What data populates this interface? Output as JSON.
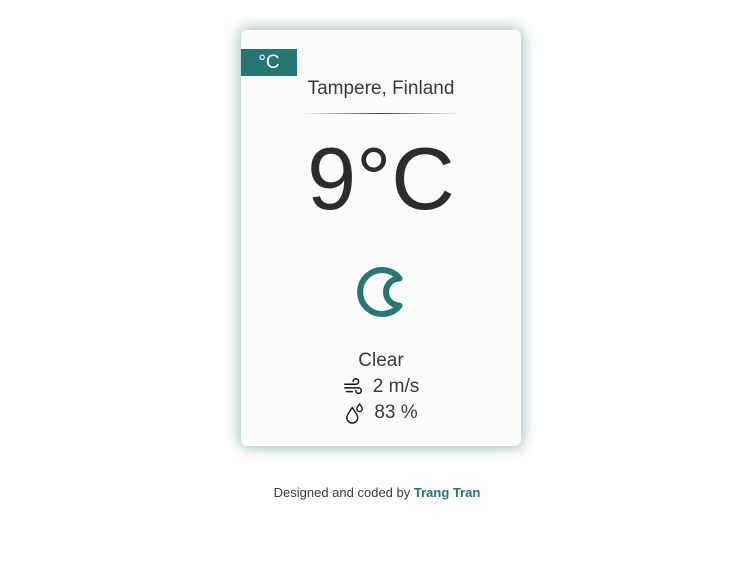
{
  "unit_toggle": {
    "label": "°C"
  },
  "location": "Tampere, Finland",
  "temperature": "9°C",
  "weather": {
    "icon": "crescent-moon-icon",
    "condition": "Clear",
    "wind": "2 m/s",
    "wind_icon": "wind-icon",
    "humidity": "83 %",
    "humidity_icon": "droplets-icon"
  },
  "footer": {
    "prefix": "Designed and coded by",
    "author": "Trang Tran"
  },
  "colors": {
    "accent": "#267672",
    "text": "#3a3a3a",
    "card_bg": "#fbfdfb"
  }
}
